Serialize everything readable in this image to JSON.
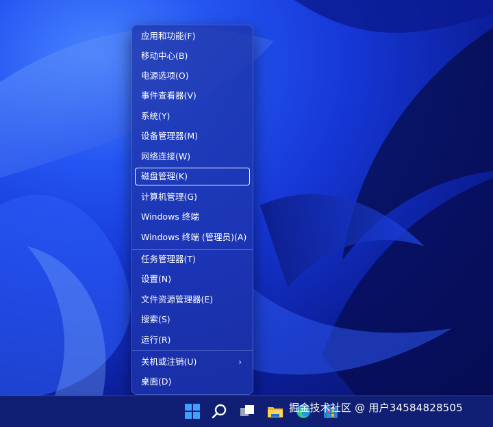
{
  "menu": {
    "items": [
      {
        "label": "应用和功能(F)"
      },
      {
        "label": "移动中心(B)"
      },
      {
        "label": "电源选项(O)"
      },
      {
        "label": "事件查看器(V)"
      },
      {
        "label": "系统(Y)"
      },
      {
        "label": "设备管理器(M)"
      },
      {
        "label": "网络连接(W)"
      },
      {
        "label": "磁盘管理(K)",
        "selected": true
      },
      {
        "label": "计算机管理(G)"
      },
      {
        "label": "Windows 终端"
      },
      {
        "label": "Windows 终端 (管理员)(A)"
      },
      {
        "label": "任务管理器(T)"
      },
      {
        "label": "设置(N)"
      },
      {
        "label": "文件资源管理器(E)"
      },
      {
        "label": "搜索(S)"
      },
      {
        "label": "运行(R)"
      },
      {
        "label": "关机或注销(U)",
        "has_submenu": true,
        "submenu_icon": "chevron-right-icon"
      },
      {
        "label": "桌面(D)"
      }
    ]
  },
  "taskbar": {
    "icons": [
      "windows-start-icon",
      "search-icon",
      "task-view-icon",
      "file-explorer-icon",
      "edge-icon",
      "store-icon"
    ]
  },
  "watermark": "掘金技术社区 @ 用户34584828505",
  "colors": {
    "accent": "#2455f2",
    "menu_bg": "#1e34aa",
    "taskbar_bg": "#101f73",
    "text": "#ffffff"
  }
}
